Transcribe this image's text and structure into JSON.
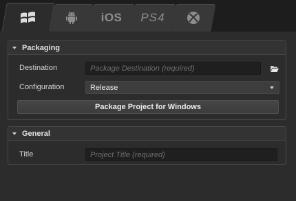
{
  "tabs": [
    {
      "id": "windows",
      "icon": "windows-logo-icon",
      "label": "",
      "active": true
    },
    {
      "id": "android",
      "icon": "android-logo-icon",
      "label": "",
      "active": false
    },
    {
      "id": "ios",
      "icon": "",
      "label": "iOS",
      "active": false
    },
    {
      "id": "ps4",
      "icon": "",
      "label": "PS4",
      "active": false
    },
    {
      "id": "xbox",
      "icon": "xbox-logo-icon",
      "label": "",
      "active": false
    }
  ],
  "packaging": {
    "title": "Packaging",
    "destination_label": "Destination",
    "destination_placeholder": "Package Destination (required)",
    "configuration_label": "Configuration",
    "configuration_value": "Release",
    "package_button": "Package Project for Windows"
  },
  "general": {
    "title": "General",
    "title_label": "Title",
    "title_placeholder": "Project Title (required)"
  },
  "colors": {
    "background": "#2c2c2c",
    "tabbar": "#1d1d1d",
    "input_bg": "#1f1f1f",
    "text": "#d6d6d6",
    "placeholder": "#6e6e6e"
  }
}
